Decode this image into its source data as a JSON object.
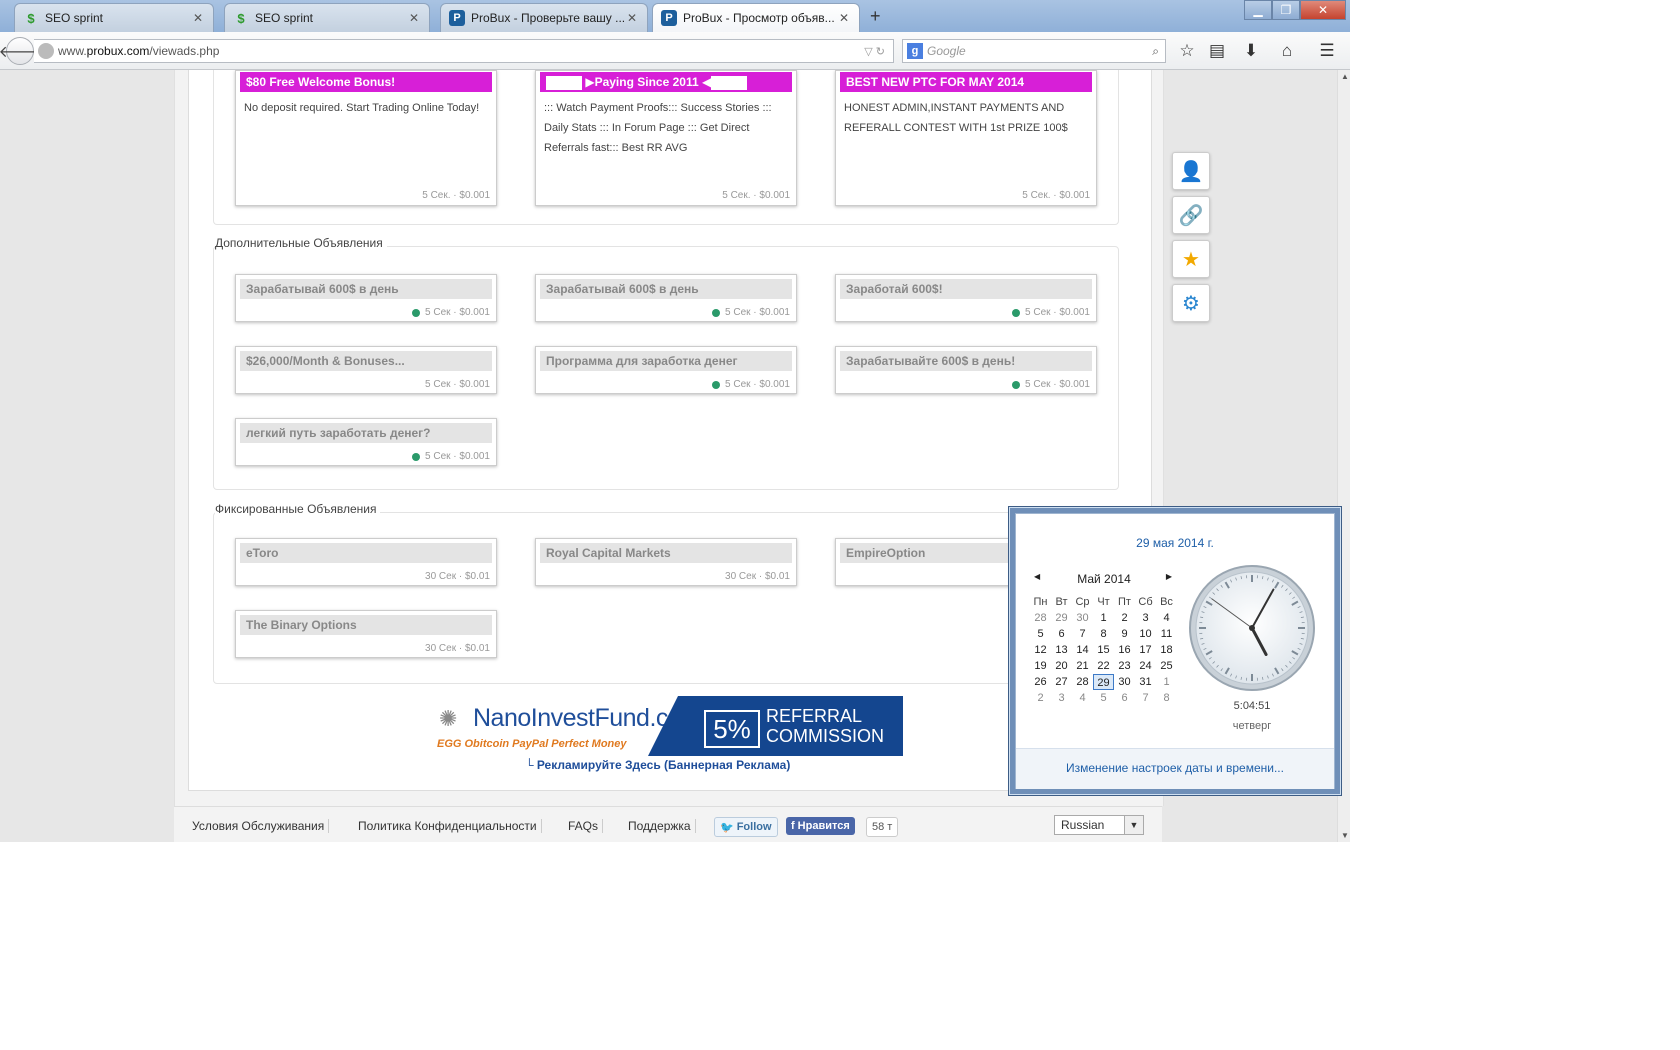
{
  "browser": {
    "tabs": [
      {
        "label": "SEO sprint",
        "icon": "seo-icon"
      },
      {
        "label": "SEO sprint",
        "icon": "seo-icon"
      },
      {
        "label": "ProBux - Проверьте вашу ...",
        "icon": "probux-icon"
      },
      {
        "label": "ProBux - Просмотр объяв...",
        "icon": "probux-icon",
        "active": true
      }
    ],
    "url_prefix": "www.",
    "url_domain": "probux.com",
    "url_path": "/viewads.php",
    "search_placeholder": "Google"
  },
  "top_ads": [
    {
      "title": "$80 Free Welcome Bonus!",
      "desc": "No deposit required. Start Trading Online Today!",
      "meta": "5 Сек. · $0.001"
    },
    {
      "title": "Paying Since 2011",
      "desc": "::: Watch Payment Proofs::: Success Stories ::: Daily Stats ::: In Forum Page ::: Get Direct Referrals fast::: Best RR AVG",
      "meta": "5 Сек. · $0.001"
    },
    {
      "title": "BEST NEW PTC FOR MAY 2014",
      "desc": "HONEST ADMIN,INSTANT PAYMENTS AND REFERALL CONTEST WITH 1st PRIZE 100$",
      "meta": "5 Сек. · $0.001"
    }
  ],
  "extra_section_label": "Дополнительные Объявления",
  "extra_ads": [
    {
      "title": "Зарабатывай 600$ в день",
      "meta": "5 Сек · $0.001",
      "dot": true
    },
    {
      "title": "Зарабатывай 600$ в день",
      "meta": "5 Сек · $0.001",
      "dot": true
    },
    {
      "title": "Заработай 600$!",
      "meta": "5 Сек · $0.001",
      "dot": true
    },
    {
      "title": "$26,000/Month & Bonuses...",
      "meta": "5 Сек · $0.001",
      "dot": false
    },
    {
      "title": "Программа для заработка денег",
      "meta": "5 Сек · $0.001",
      "dot": true
    },
    {
      "title": "Зарабатывайте 600$ в день!",
      "meta": "5 Сек · $0.001",
      "dot": true
    },
    {
      "title": "легкий путь заработать денег?",
      "meta": "5 Сек · $0.001",
      "dot": true
    }
  ],
  "fixed_section_label": "Фиксированные Объявления",
  "fixed_ads": [
    {
      "title": "eToro",
      "meta": "30 Сек · $0.01"
    },
    {
      "title": "Royal Capital Markets",
      "meta": "30 Сек · $0.01"
    },
    {
      "title": "EmpireOption",
      "meta": ""
    },
    {
      "title": "The Binary Options",
      "meta": "30 Сек · $0.01"
    }
  ],
  "banner": {
    "brand": "NanoInvestFund.com",
    "payments": "EGG  Obitcoin  PayPal  Perfect Money",
    "percent": "5%",
    "referral_line1": "REFERRAL",
    "referral_line2": "COMMISSION",
    "advertise_link": "└ Рекламируйте Здесь (Баннерная Реклама)"
  },
  "footer": {
    "links": [
      "Условия Обслуживания",
      "Политика Конфиденциальности",
      "FAQs",
      "Поддержка"
    ],
    "twitter_label": "Follow",
    "facebook_label": "Нравится",
    "facebook_count": "58 т",
    "language": "Russian"
  },
  "calendar_popup": {
    "date_header": "29 мая 2014 г.",
    "month_title": "Май 2014",
    "weekdays": [
      "Пн",
      "Вт",
      "Ср",
      "Чт",
      "Пт",
      "Сб",
      "Вс"
    ],
    "weeks": [
      [
        "28",
        "29",
        "30",
        "1",
        "2",
        "3",
        "4"
      ],
      [
        "5",
        "6",
        "7",
        "8",
        "9",
        "10",
        "11"
      ],
      [
        "12",
        "13",
        "14",
        "15",
        "16",
        "17",
        "18"
      ],
      [
        "19",
        "20",
        "21",
        "22",
        "23",
        "24",
        "25"
      ],
      [
        "26",
        "27",
        "28",
        "29",
        "30",
        "31",
        "1"
      ],
      [
        "2",
        "3",
        "4",
        "5",
        "6",
        "7",
        "8"
      ]
    ],
    "today": "29",
    "time": "5:04:51",
    "day_name": "четверг",
    "settings_link": "Изменение настроек даты и времени..."
  }
}
